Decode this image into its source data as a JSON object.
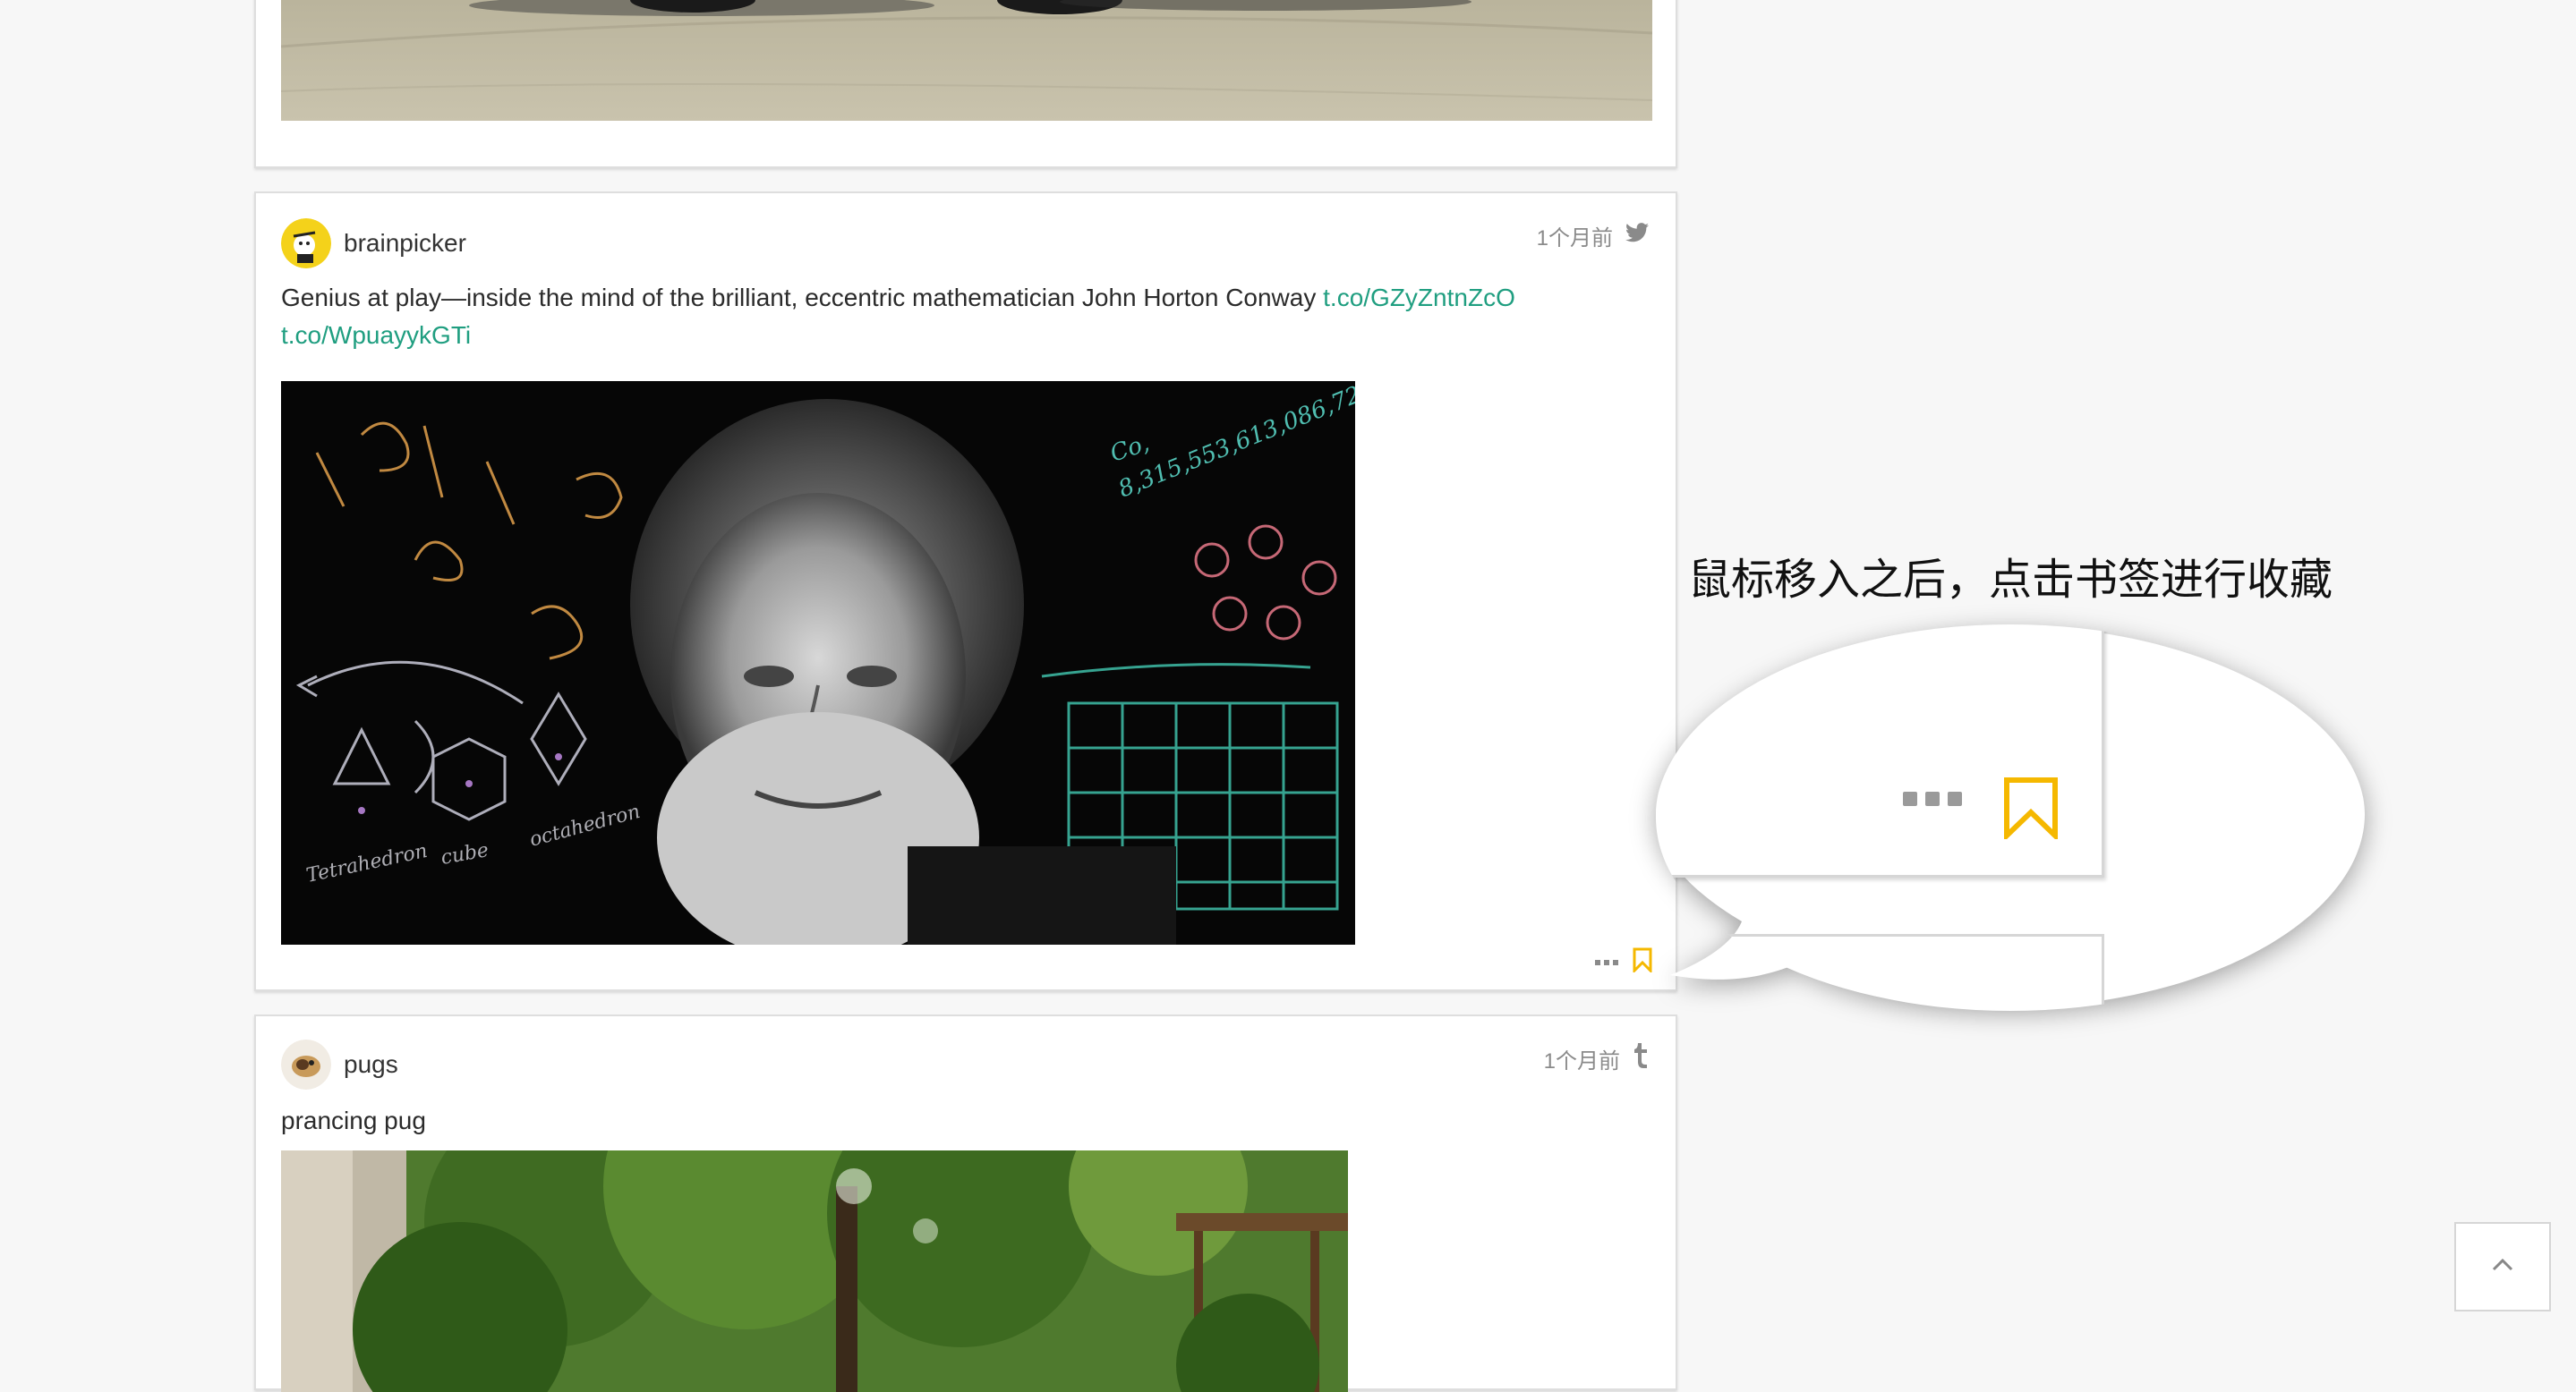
{
  "colors": {
    "accent_link": "#1f9e80",
    "bookmark": "#f5b800",
    "muted": "#8a8a8a"
  },
  "posts": [
    {
      "id_label": "top-card",
      "image": "car-on-pavement-photo"
    },
    {
      "username": "brainpicker",
      "time": "1个月前",
      "source_icon": "twitter-icon",
      "text": "Genius at play—inside the mind of the brilliant, eccentric mathematician John Horton Conway ",
      "link1": "t.co/GZyZntnZcO",
      "link2": "t.co/WpuayykGTi",
      "image": "john-horton-conway-photo",
      "more_icon": "more-dots-icon",
      "bookmark_icon": "bookmark-icon"
    },
    {
      "username": "pugs",
      "time": "1个月前",
      "source_icon": "tumblr-icon",
      "text": "prancing pug",
      "image": "garden-trees-photo"
    }
  ],
  "annotation": {
    "text": "鼠标移入之后，点击书签进行收藏"
  },
  "back_to_top": {
    "icon": "chevron-up-icon"
  }
}
